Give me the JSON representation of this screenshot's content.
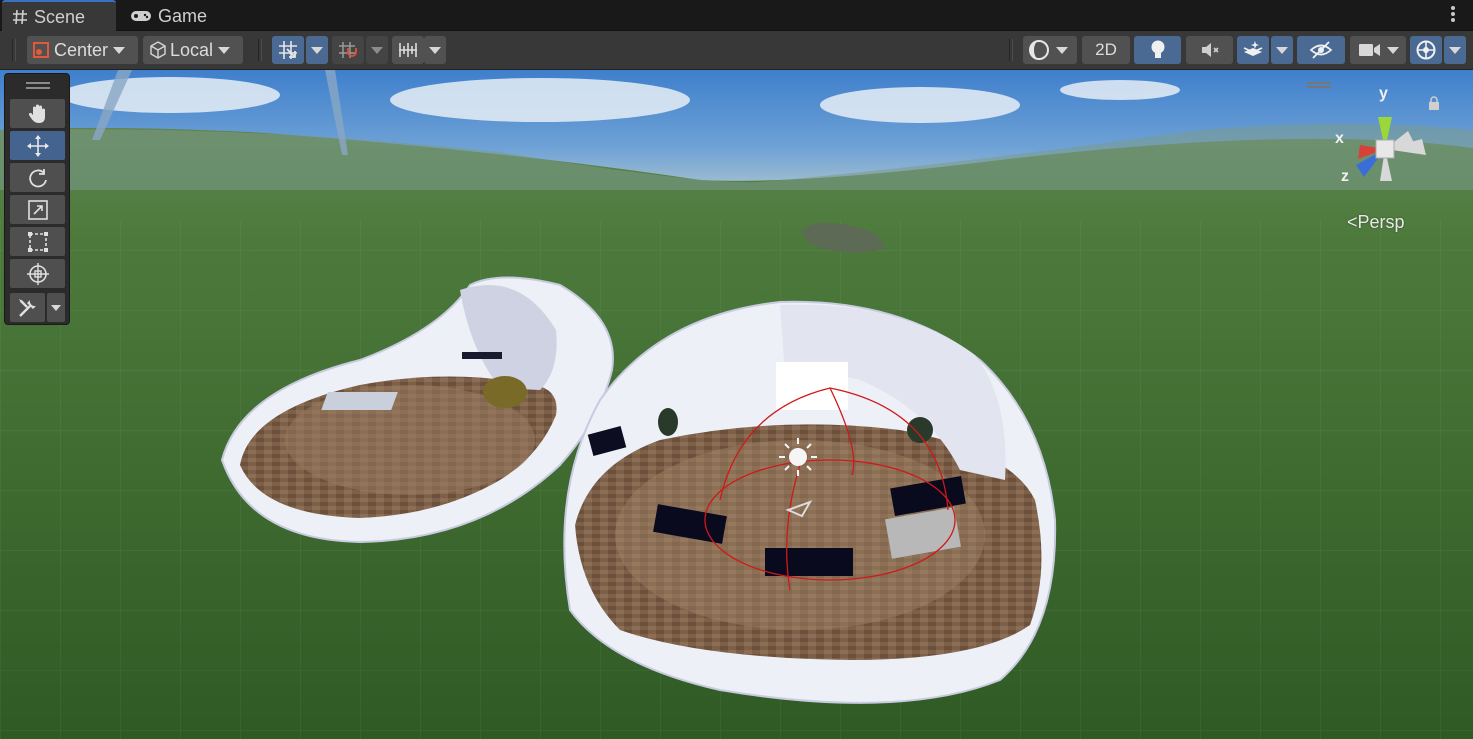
{
  "tabs": [
    {
      "label": "Scene",
      "icon": "hash-icon",
      "active": true
    },
    {
      "label": "Game",
      "icon": "gamepad-icon",
      "active": false
    }
  ],
  "toolbar": {
    "pivot_label": "Center",
    "rotation_label": "Local",
    "mode_2d_label": "2D"
  },
  "gizmo": {
    "axis_x": "x",
    "axis_y": "y",
    "axis_z": "z",
    "projection_label": "Persp"
  },
  "colors": {
    "accent": "#4a6a94",
    "toolbar_bg": "#383838",
    "tab_bg": "#191919",
    "axis_x": "#d6423a",
    "axis_y": "#9bd63a",
    "axis_z": "#3a6ed6"
  },
  "tools": [
    "hand-tool-icon",
    "move-tool-icon",
    "rotate-tool-icon",
    "scale-tool-icon",
    "rect-tool-icon",
    "transform-tool-icon",
    "custom-tool-icon"
  ]
}
